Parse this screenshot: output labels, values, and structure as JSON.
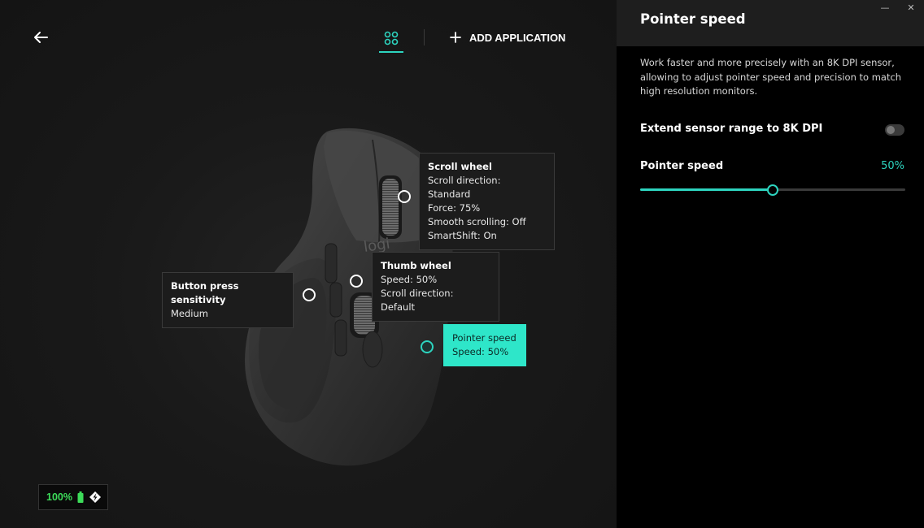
{
  "main": {
    "add_application_label": "ADD APPLICATION",
    "callouts": {
      "scroll_wheel": {
        "title": "Scroll wheel",
        "lines": [
          "Scroll direction: Standard",
          "Force: 75%",
          "Smooth scrolling: Off",
          "SmartShift: On"
        ]
      },
      "thumb_wheel": {
        "title": "Thumb wheel",
        "lines": [
          "Speed: 50%",
          "Scroll direction: Default"
        ]
      },
      "button_press": {
        "title": "Button press sensitivity",
        "lines": [
          "Medium"
        ]
      },
      "pointer_speed": {
        "title": "Pointer speed",
        "lines": [
          "Speed: 50%"
        ]
      }
    },
    "mouse_logo_text": "logi",
    "battery": {
      "percent_label": "100%",
      "level": 1.0
    }
  },
  "panel": {
    "title": "Pointer speed",
    "description": "Work faster and more precisely with an 8K DPI sensor, allowing to adjust pointer speed and precision to match high resolution monitors.",
    "extend_sensor_label": "Extend sensor range to 8K DPI",
    "extend_sensor_on": false,
    "pointer_speed_label": "Pointer speed",
    "pointer_speed_value_label": "50%",
    "pointer_speed_fraction": 0.5,
    "window_controls": {
      "minimize": "—",
      "close": "✕"
    }
  },
  "colors": {
    "accent": "#2dd4bf",
    "battery_green": "#3ddc5a",
    "panel_bg": "#000000",
    "panel_header_bg": "#1e1e1e"
  }
}
